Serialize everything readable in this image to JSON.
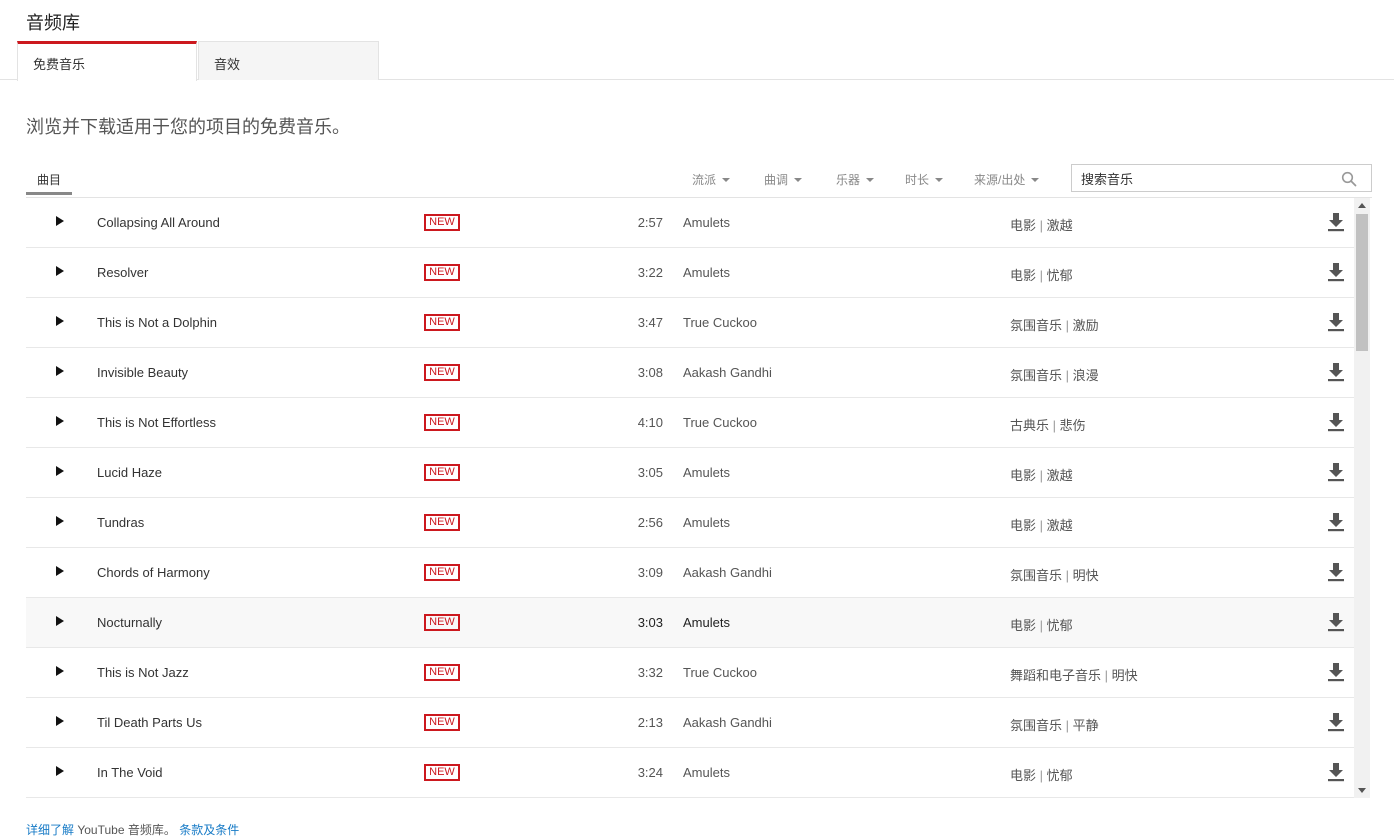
{
  "page": {
    "title": "音频库"
  },
  "tabs": [
    {
      "label": "免费音乐"
    },
    {
      "label": "音效"
    }
  ],
  "description": "浏览并下载适用于您的项目的免费音乐。",
  "toolbar": {
    "subtab": "曲目",
    "filters": [
      {
        "label": "流派"
      },
      {
        "label": "曲调"
      },
      {
        "label": "乐器"
      },
      {
        "label": "时长"
      },
      {
        "label": "来源/出处"
      }
    ],
    "search_placeholder": "搜索音乐"
  },
  "badge_label": "NEW",
  "colors": {
    "accent": "#cc181e",
    "link": "#167ac6"
  },
  "tracks": [
    {
      "title": "Collapsing All Around",
      "duration": "2:57",
      "artist": "Amulets",
      "genre": "电影",
      "mood": "激越"
    },
    {
      "title": "Resolver",
      "duration": "3:22",
      "artist": "Amulets",
      "genre": "电影",
      "mood": "忧郁"
    },
    {
      "title": "This is Not a Dolphin",
      "duration": "3:47",
      "artist": "True Cuckoo",
      "genre": "氛围音乐",
      "mood": "激励"
    },
    {
      "title": "Invisible Beauty",
      "duration": "3:08",
      "artist": "Aakash Gandhi",
      "genre": "氛围音乐",
      "mood": "浪漫"
    },
    {
      "title": "This is Not Effortless",
      "duration": "4:10",
      "artist": "True Cuckoo",
      "genre": "古典乐",
      "mood": "悲伤"
    },
    {
      "title": "Lucid Haze",
      "duration": "3:05",
      "artist": "Amulets",
      "genre": "电影",
      "mood": "激越"
    },
    {
      "title": "Tundras",
      "duration": "2:56",
      "artist": "Amulets",
      "genre": "电影",
      "mood": "激越"
    },
    {
      "title": "Chords of Harmony",
      "duration": "3:09",
      "artist": "Aakash Gandhi",
      "genre": "氛围音乐",
      "mood": "明快"
    },
    {
      "title": "Nocturnally",
      "duration": "3:03",
      "artist": "Amulets",
      "genre": "电影",
      "mood": "忧郁"
    },
    {
      "title": "This is Not Jazz",
      "duration": "3:32",
      "artist": "True Cuckoo",
      "genre": "舞蹈和电子音乐",
      "mood": "明快"
    },
    {
      "title": "Til Death Parts Us",
      "duration": "2:13",
      "artist": "Aakash Gandhi",
      "genre": "氛围音乐",
      "mood": "平静"
    },
    {
      "title": "In The Void",
      "duration": "3:24",
      "artist": "Amulets",
      "genre": "电影",
      "mood": "忧郁"
    }
  ],
  "footer": {
    "learn_more": "详细了解",
    "middle": " YouTube 音频库。 ",
    "terms": "条款及条件"
  }
}
